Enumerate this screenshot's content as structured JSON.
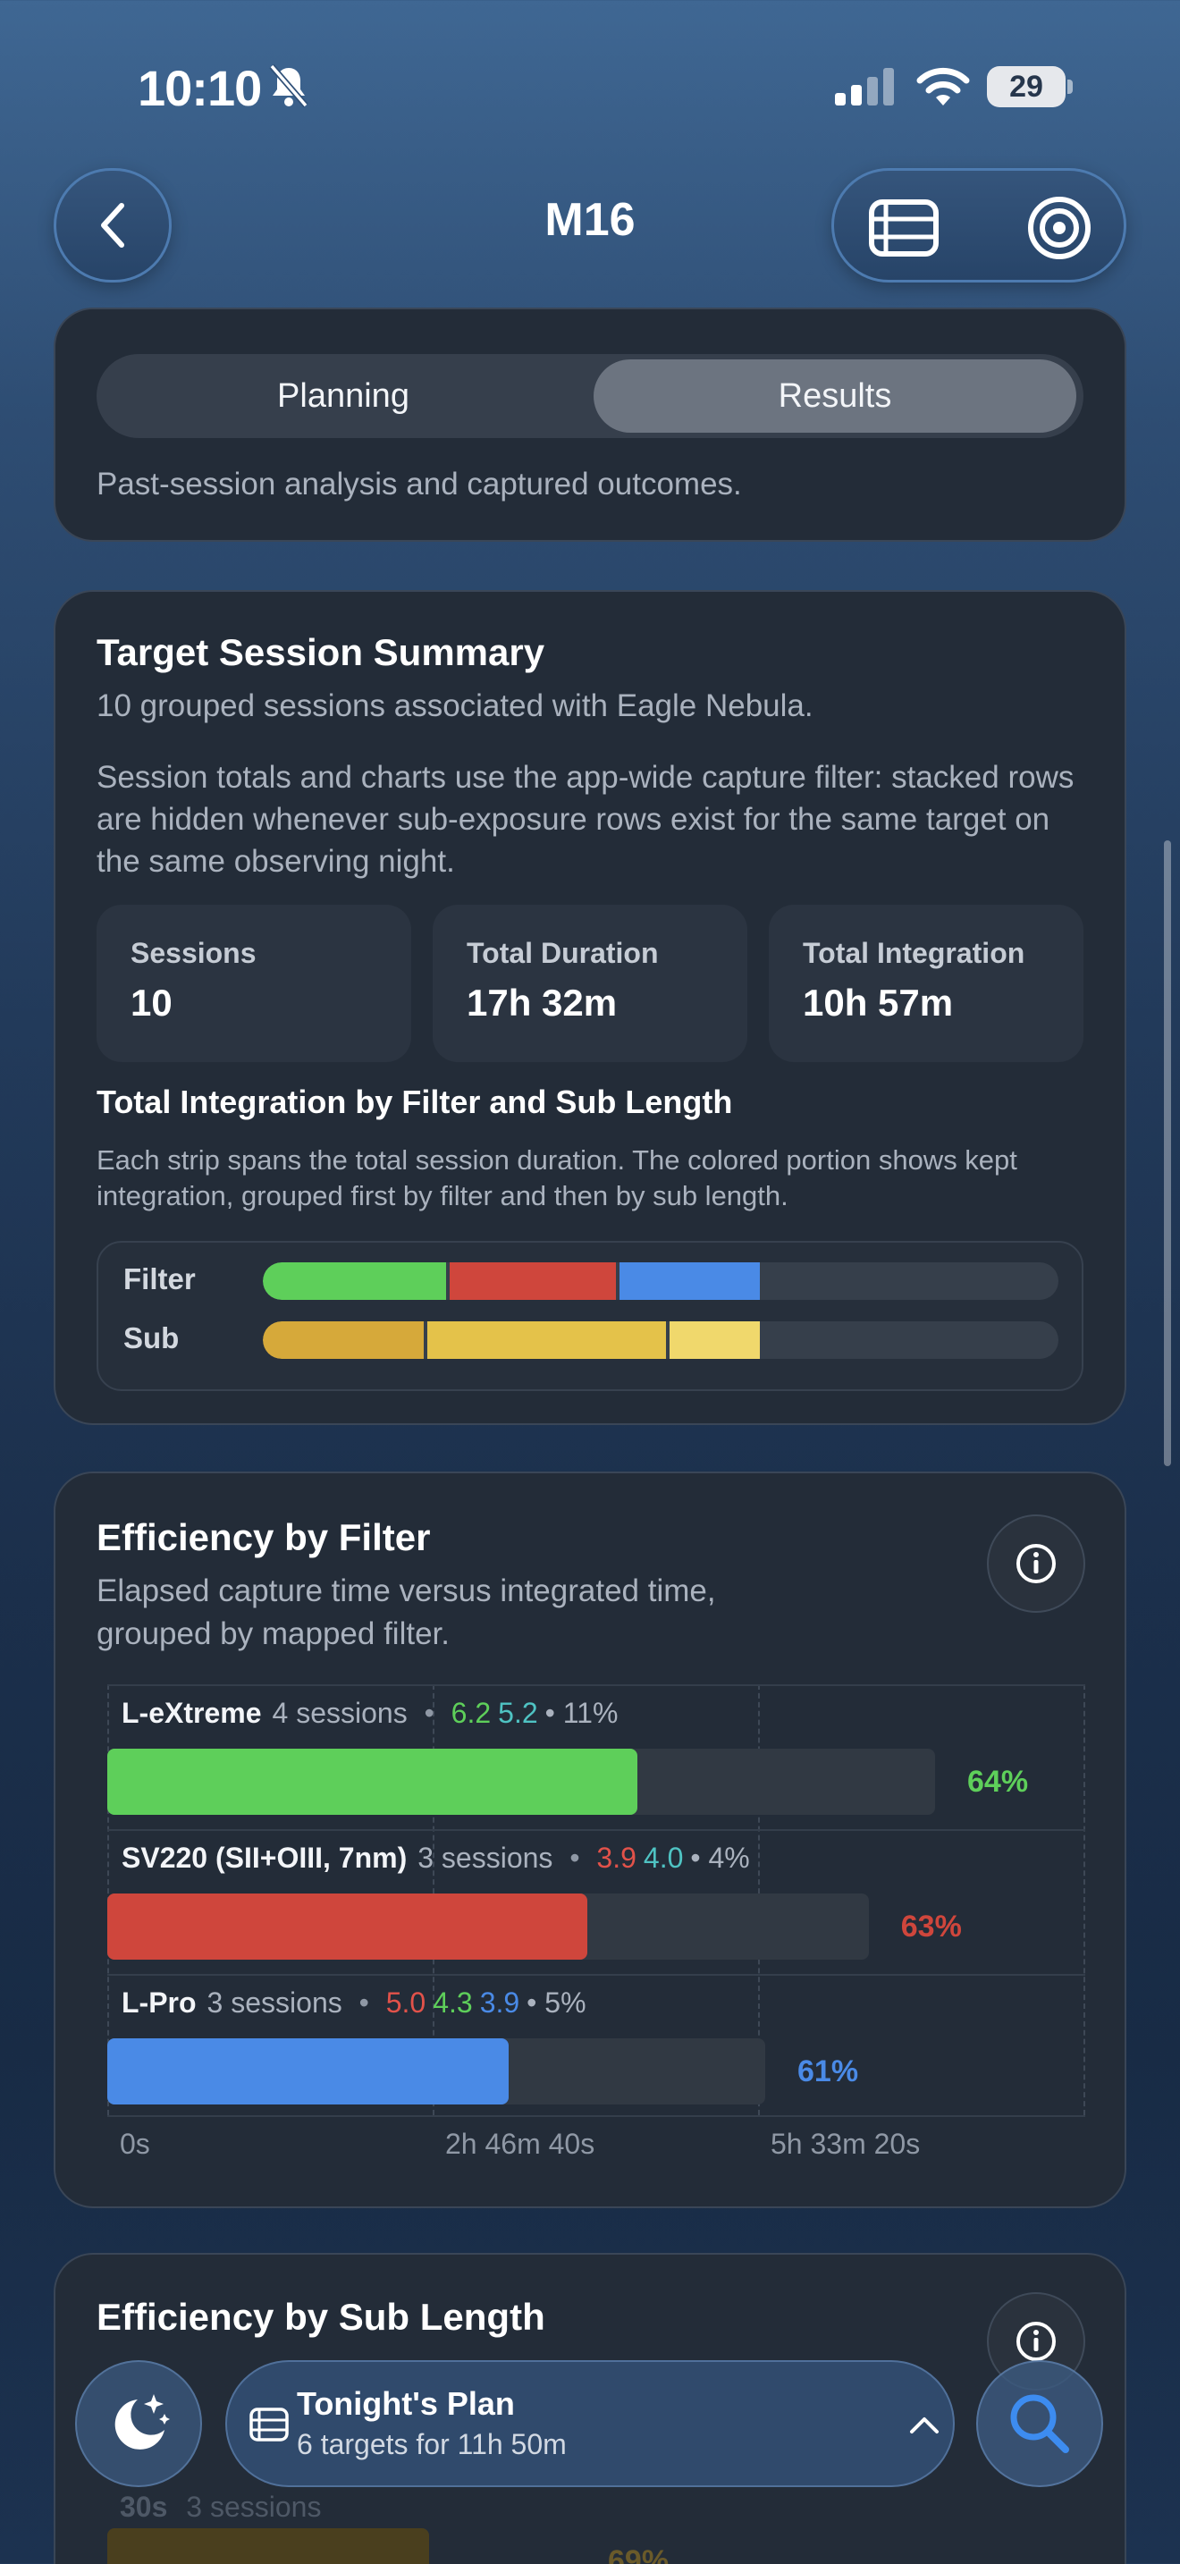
{
  "status_bar": {
    "time": "10:10",
    "battery": "29"
  },
  "nav": {
    "title": "M16"
  },
  "mode_card": {
    "tabs": [
      {
        "label": "Planning"
      },
      {
        "label": "Results"
      }
    ],
    "active_tab": "Results",
    "description": "Past-session analysis and captured outcomes."
  },
  "summary": {
    "title": "Target Session Summary",
    "subtitle": "10 grouped sessions associated with Eagle Nebula.",
    "note": "Session totals and charts use the app-wide capture filter: stacked rows are hidden whenever sub-exposure rows exist for the same target on the same observing night.",
    "stats": [
      {
        "label": "Sessions",
        "value": "10"
      },
      {
        "label": "Total Duration",
        "value": "17h 32m"
      },
      {
        "label": "Total Integration",
        "value": "10h 57m"
      }
    ],
    "integration_title": "Total Integration by Filter and Sub Length",
    "integration_note": "Each strip spans the total session duration. The colored portion shows kept integration, grouped first by filter and then by sub length.",
    "strips": [
      {
        "label": "Filter",
        "segments": [
          {
            "fraction": 0.235,
            "color": "#5ecf5a"
          },
          {
            "fraction": 0.213,
            "color": "#cf463c"
          },
          {
            "fraction": 0.177,
            "color": "#4a8ae6"
          }
        ]
      },
      {
        "label": "Sub",
        "segments": [
          {
            "fraction": 0.207,
            "color": "#d6a93a"
          },
          {
            "fraction": 0.304,
            "color": "#e4c24a"
          },
          {
            "fraction": 0.114,
            "color": "#f0d86c"
          }
        ]
      }
    ]
  },
  "efficiency_filter": {
    "title": "Efficiency by Filter",
    "subtitle": "Elapsed capture time versus integrated time, grouped by mapped filter.",
    "ticks": [
      "0s",
      "2h 46m 40s",
      "5h 33m 20s"
    ],
    "axis_max_seconds": 30000,
    "rows": [
      {
        "name": "L-eXtreme",
        "sessions": "4 sessions",
        "dot": "•",
        "values": [
          {
            "text": "6.2",
            "color": "#5ecf5a"
          },
          {
            "text": "5.2",
            "color": "#4fc3c3"
          }
        ],
        "share": "11%",
        "elapsed_fraction": 0.848,
        "pct": 64,
        "pct_label": "64%",
        "color": "#5ecf5a"
      },
      {
        "name": "SV220 (SII+OIII, 7nm)",
        "sessions": "3 sessions",
        "dot": "•",
        "values": [
          {
            "text": "3.9",
            "color": "#e2524a"
          },
          {
            "text": "4.0",
            "color": "#4fc3c3"
          }
        ],
        "share": "4%",
        "elapsed_fraction": 0.78,
        "pct": 63,
        "pct_label": "63%",
        "color": "#cf463c"
      },
      {
        "name": "L-Pro",
        "sessions": "3 sessions",
        "dot": "•",
        "values": [
          {
            "text": "5.0",
            "color": "#e2524a"
          },
          {
            "text": "4.3",
            "color": "#5ecf5a"
          },
          {
            "text": "3.9",
            "color": "#4a8ae6"
          }
        ],
        "share": "5%",
        "elapsed_fraction": 0.674,
        "pct": 61,
        "pct_label": "61%",
        "color": "#4a8ae6"
      }
    ]
  },
  "efficiency_sub": {
    "title": "Efficiency by Sub Length",
    "row_label": "30s",
    "row_sessions": "3 sessions",
    "row_pct": "69%"
  },
  "dock": {
    "plan_title": "Tonight's Plan",
    "plan_subtitle": "6 targets for 11h 50m"
  }
}
